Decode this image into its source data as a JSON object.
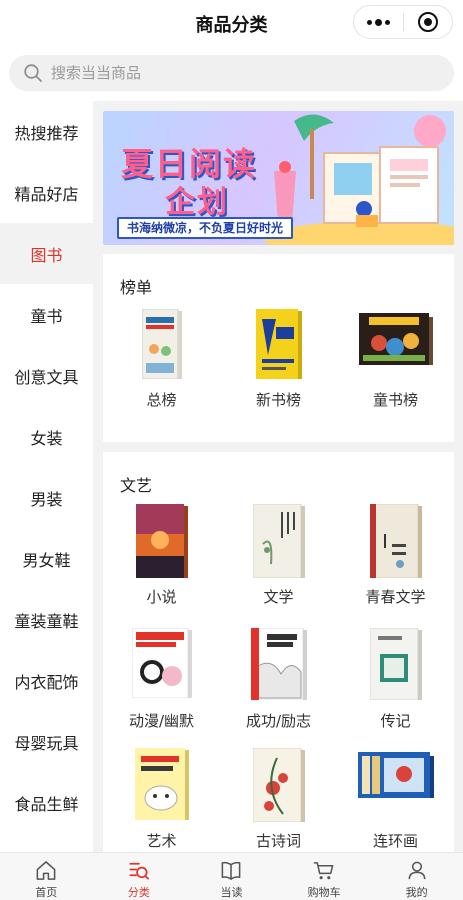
{
  "header": {
    "title": "商品分类"
  },
  "search": {
    "placeholder": "搜索当当商品"
  },
  "sidebar": {
    "items": [
      {
        "label": "热搜推荐"
      },
      {
        "label": "精品好店"
      },
      {
        "label": "图书",
        "active": true
      },
      {
        "label": "童书"
      },
      {
        "label": "创意文具"
      },
      {
        "label": "女装"
      },
      {
        "label": "男装"
      },
      {
        "label": "男女鞋"
      },
      {
        "label": "童装童鞋"
      },
      {
        "label": "内衣配饰"
      },
      {
        "label": "母婴玩具"
      },
      {
        "label": "食品生鲜"
      }
    ]
  },
  "banner": {
    "headline_1": "夏日阅读",
    "headline_2": "企划",
    "slogan": "书海纳微凉，不负夏日好时光"
  },
  "sections": [
    {
      "title": "榜单",
      "items": [
        {
          "label": "总榜",
          "cover_color": "#f2efe6"
        },
        {
          "label": "新书榜",
          "cover_color": "#f4d21c"
        },
        {
          "label": "童书榜",
          "cover_color": "#2a1e18"
        }
      ]
    },
    {
      "title": "文艺",
      "items": [
        {
          "label": "小说",
          "cover_color": "#e06a2a"
        },
        {
          "label": "文学",
          "cover_color": "#f1efe6"
        },
        {
          "label": "青春文学",
          "cover_color": "#efe9dc"
        },
        {
          "label": "动漫/幽默",
          "cover_color": "#ffffff"
        },
        {
          "label": "成功/励志",
          "cover_color": "#ffffff"
        },
        {
          "label": "传记",
          "cover_color": "#f3f3f0"
        },
        {
          "label": "艺术",
          "cover_color": "#fff3a8"
        },
        {
          "label": "古诗词",
          "cover_color": "#f7f2e6"
        },
        {
          "label": "连环画",
          "cover_color": "#1f5fb5"
        }
      ]
    }
  ],
  "tabbar": {
    "tabs": [
      {
        "label": "首页",
        "icon": "home-icon"
      },
      {
        "label": "分类",
        "icon": "category-icon",
        "active": true
      },
      {
        "label": "当读",
        "icon": "book-icon"
      },
      {
        "label": "购物车",
        "icon": "cart-icon"
      },
      {
        "label": "我的",
        "icon": "user-icon"
      }
    ]
  },
  "colors": {
    "accent": "#e2332a",
    "background": "#f2f2f2"
  }
}
